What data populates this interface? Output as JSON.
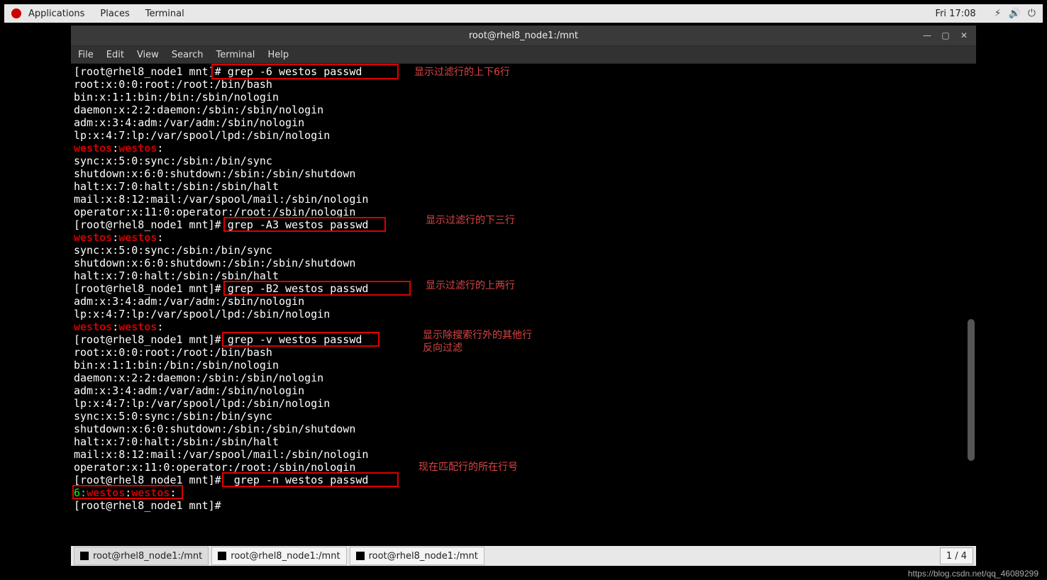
{
  "topbar": {
    "applications": "Applications",
    "places": "Places",
    "terminal": "Terminal",
    "clock": "Fri 17:08"
  },
  "window": {
    "title": "root@rhel8_node1:/mnt"
  },
  "menu": {
    "file": "File",
    "edit": "Edit",
    "view": "View",
    "search": "Search",
    "terminal": "Terminal",
    "help": "Help"
  },
  "terminal": {
    "prompt": "[root@rhel8_node1 mnt]# ",
    "cmd1": "grep -6 westos passwd",
    "cmd2": "grep -A3 westos passwd",
    "cmd3": "grep -B2 westos passwd",
    "cmd4": "grep -v westos passwd",
    "cmd5": " grep -n westos passwd",
    "l_root": "root:x:0:0:root:/root:/bin/bash",
    "l_bin": "bin:x:1:1:bin:/bin:/sbin/nologin",
    "l_daemon": "daemon:x:2:2:daemon:/sbin:/sbin/nologin",
    "l_adm": "adm:x:3:4:adm:/var/adm:/sbin/nologin",
    "l_lp": "lp:x:4:7:lp:/var/spool/lpd:/sbin/nologin",
    "westos": "westos",
    "colon": ":",
    "l_sync": "sync:x:5:0:sync:/sbin:/bin/sync",
    "l_shutdown": "shutdown:x:6:0:shutdown:/sbin:/sbin/shutdown",
    "l_halt": "halt:x:7:0:halt:/sbin:/sbin/halt",
    "l_mail": "mail:x:8:12:mail:/var/spool/mail:/sbin/nologin",
    "l_operator": "operator:x:11:0:operator:/root:/sbin/nologin",
    "n6": "6"
  },
  "annotations": {
    "a1": "显示过滤行的上下6行",
    "a2": "显示过滤行的下三行",
    "a3": "显示过滤行的上两行",
    "a4a": "显示除搜索行外的其他行",
    "a4b": "反向过滤",
    "a5": "现在匹配行的所在行号"
  },
  "taskbar": {
    "tab1": "root@rhel8_node1:/mnt",
    "tab2": "root@rhel8_node1:/mnt",
    "tab3": "root@rhel8_node1:/mnt",
    "workspace": "1 / 4"
  },
  "watermark": "https://blog.csdn.net/qq_46089299"
}
